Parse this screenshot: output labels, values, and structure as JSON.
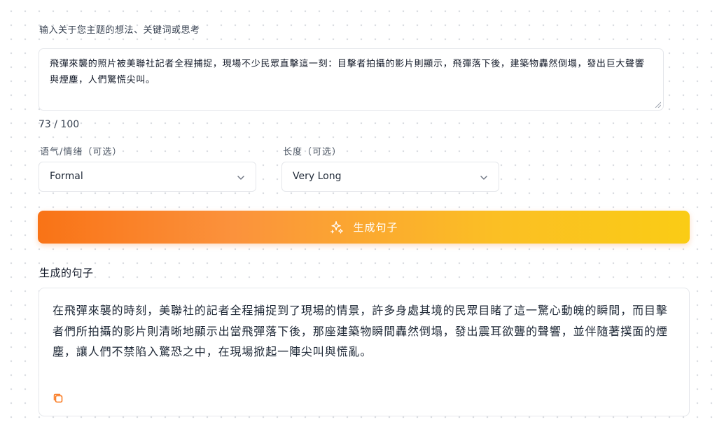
{
  "form": {
    "prompt_label": "输入关于您主题的想法、关键词或思考",
    "prompt_value": "飛彈來襲的照片被美聯社記者全程捕捉，現場不少民眾直擊這一刻：目擊者拍攝的影片則顯示，飛彈落下後，建築物轟然倒塌，發出巨大聲響與煙塵，人們驚慌尖叫。",
    "char_count": "73 / 100",
    "tone": {
      "label": "语气/情绪（可选）",
      "value": "Formal"
    },
    "length": {
      "label": "长度（可选）",
      "value": "Very Long"
    },
    "generate_label": "生成句子"
  },
  "result": {
    "heading": "生成的句子",
    "text": "在飛彈來襲的時刻，美聯社的記者全程捕捉到了現場的情景，許多身處其境的民眾目睹了這一驚心動魄的瞬間，而目擊者們所拍攝的影片則清晰地顯示出當飛彈落下後，那座建築物瞬間轟然倒塌，發出震耳欲聾的聲響，並伴隨著撲面的煙塵，讓人們不禁陷入驚恐之中，在現場掀起一陣尖叫與慌亂。"
  },
  "icons": {
    "generate": "sparkles-icon",
    "copy": "copy-icon",
    "select": "chevron-down-icon",
    "resize": "resize-handle-icon"
  },
  "colors": {
    "accent_start": "#f97316",
    "accent_end": "#facc15",
    "copy_icon": "#f97316"
  }
}
